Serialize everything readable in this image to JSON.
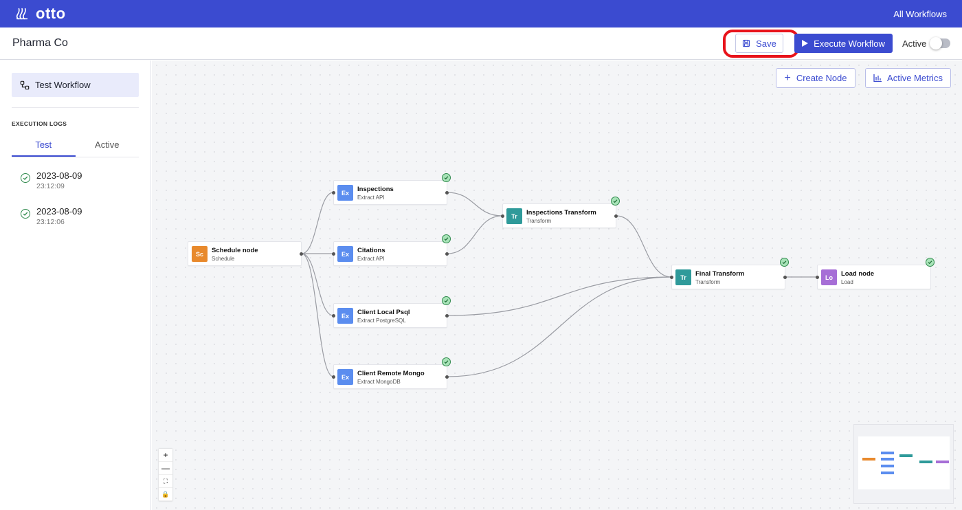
{
  "app": {
    "brand": "otto",
    "nav_all_workflows": "All Workflows"
  },
  "header": {
    "title": "Pharma Co",
    "save_label": "Save",
    "execute_label": "Execute Workflow",
    "active_label": "Active",
    "active_on": false
  },
  "sidebar": {
    "workflow_label": "Test Workflow",
    "exec_logs_heading": "EXECUTION LOGS",
    "tabs": [
      {
        "label": "Test",
        "selected": true
      },
      {
        "label": "Active",
        "selected": false
      }
    ],
    "logs": [
      {
        "date": "2023-08-09",
        "time": "23:12:09",
        "status": "success"
      },
      {
        "date": "2023-08-09",
        "time": "23:12:06",
        "status": "success"
      }
    ]
  },
  "canvas": {
    "create_node_label": "Create Node",
    "active_metrics_label": "Active Metrics",
    "zoom_controls": [
      "+",
      "—",
      "⛶",
      "🔒"
    ]
  },
  "nodes": [
    {
      "id": "schedule",
      "badge": "Sc",
      "title": "Schedule node",
      "subtitle": "Schedule",
      "color": "#e8892c",
      "status": false
    },
    {
      "id": "inspections",
      "badge": "Ex",
      "title": "Inspections",
      "subtitle": "Extract API",
      "color": "#5b8def",
      "status": true
    },
    {
      "id": "citations",
      "badge": "Ex",
      "title": "Citations",
      "subtitle": "Extract API",
      "color": "#5b8def",
      "status": true
    },
    {
      "id": "psql",
      "badge": "Ex",
      "title": "Client Local Psql",
      "subtitle": "Extract PostgreSQL",
      "color": "#5b8def",
      "status": true
    },
    {
      "id": "mongo",
      "badge": "Ex",
      "title": "Client Remote Mongo",
      "subtitle": "Extract MongoDB",
      "color": "#5b8def",
      "status": true
    },
    {
      "id": "insp_transform",
      "badge": "Tr",
      "title": "Inspections Transform",
      "subtitle": "Transform",
      "color": "#2f9a9a",
      "status": true
    },
    {
      "id": "final_transform",
      "badge": "Tr",
      "title": "Final Transform",
      "subtitle": "Transform",
      "color": "#2f9a9a",
      "status": true
    },
    {
      "id": "load",
      "badge": "Lo",
      "title": "Load node",
      "subtitle": "Load",
      "color": "#a66ed6",
      "status": true
    }
  ],
  "edges": [
    [
      "schedule",
      "inspections"
    ],
    [
      "schedule",
      "citations"
    ],
    [
      "schedule",
      "psql"
    ],
    [
      "schedule",
      "mongo"
    ],
    [
      "inspections",
      "insp_transform"
    ],
    [
      "citations",
      "insp_transform"
    ],
    [
      "insp_transform",
      "final_transform"
    ],
    [
      "psql",
      "final_transform"
    ],
    [
      "mongo",
      "final_transform"
    ],
    [
      "final_transform",
      "load"
    ]
  ]
}
